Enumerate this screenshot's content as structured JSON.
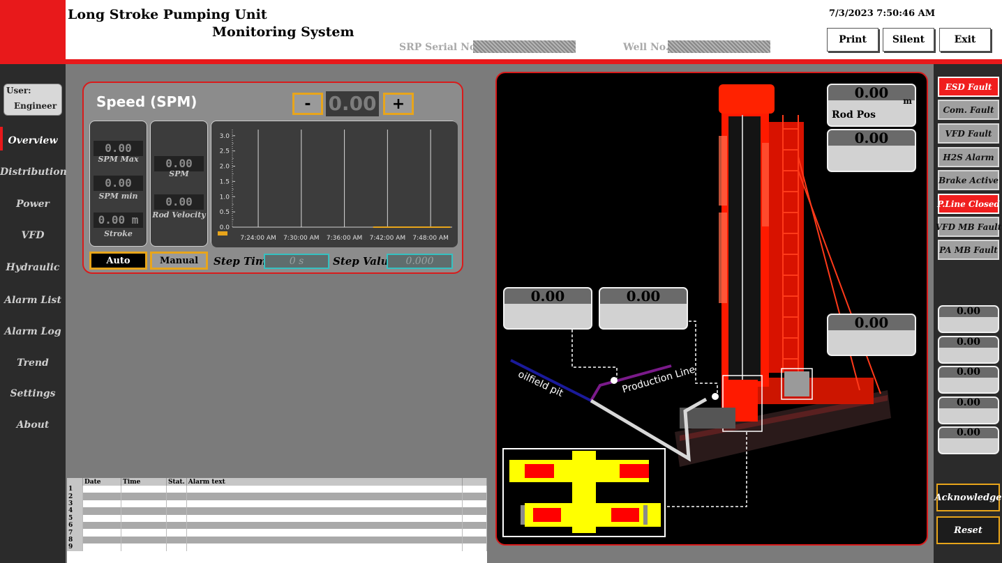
{
  "header": {
    "title_line1": "Long Stroke Pumping Unit",
    "title_line2": "Monitoring System",
    "datetime": "7/3/2023 7:50:46 AM",
    "srp_serial_label": "SRP Serial No.",
    "well_label": "Well No.",
    "buttons": {
      "print": "Print",
      "silent": "Silent",
      "exit": "Exit"
    }
  },
  "user": {
    "label": "User:",
    "name": "Engineer"
  },
  "nav": [
    "Overview",
    "Distribution",
    "Power",
    "VFD",
    "Hydraulic",
    "Alarm List",
    "Alarm Log",
    "Trend",
    "Settings",
    "About"
  ],
  "speed": {
    "title": "Speed (SPM)",
    "minus_label": "-",
    "plus_label": "+",
    "setpoint": "0.00",
    "spm_max": {
      "value": "0.00",
      "label": "SPM Max"
    },
    "spm_min": {
      "value": "0.00",
      "label": "SPM min"
    },
    "stroke": {
      "value": "0.00 m",
      "label": "Stroke"
    },
    "spm": {
      "value": "0.00",
      "label": "SPM"
    },
    "rod_velocity": {
      "value": "0.00",
      "label": "Rod Velocity"
    },
    "auto_label": "Auto",
    "manual_label": "Manual",
    "step_time_label": "Step Time",
    "step_time_value": "0 s",
    "step_value_label": "Step Value",
    "step_value_value": "0.000"
  },
  "chart_data": {
    "type": "line",
    "yticks": [
      "3.0",
      "2.5",
      "2.0",
      "1.5",
      "1.0",
      "0.5",
      "0.0"
    ],
    "ylim": [
      0,
      3.2
    ],
    "xticks": [
      "7:24:00 AM",
      "7:30:00 AM",
      "7:36:00 AM",
      "7:42:00 AM",
      "7:48:00 AM"
    ],
    "grid": true,
    "series": [
      {
        "color": "#e8a51b",
        "start_x": "7:40:00 AM",
        "end_x": "7:50:46 AM",
        "value": 0.0
      }
    ]
  },
  "alarm_table": {
    "columns": [
      "Date",
      "Time",
      "Stat.",
      "Alarm text"
    ],
    "rows": [
      "1",
      "2",
      "3",
      "4",
      "5",
      "6",
      "7",
      "8",
      "9"
    ]
  },
  "visual": {
    "rod_pos_value": "0.00",
    "rod_pos_unit": "m",
    "rod_pos_label": "Rod Pos",
    "card2_value": "0.00",
    "left_card1_value": "0.00",
    "left_card2_value": "0.00",
    "right_card_value": "0.00",
    "oilfield_pit_label": "oilfield pit",
    "production_line_label": "Production Line"
  },
  "faults": [
    {
      "label": "ESD Fault",
      "active": true
    },
    {
      "label": "Com. Fault",
      "active": false
    },
    {
      "label": "VFD Fault",
      "active": false
    },
    {
      "label": "H2S Alarm",
      "active": false
    },
    {
      "label": "Brake Active",
      "active": false
    },
    {
      "label": "P.Line Closed",
      "active": true
    },
    {
      "label": "VFD MB Fault",
      "active": false
    },
    {
      "label": "PA MB Fault",
      "active": false
    }
  ],
  "right_values": [
    "0.00",
    "0.00",
    "0.00",
    "0.00",
    "0.00"
  ],
  "actions": {
    "acknowledge": "Acknowledge",
    "reset": "Reset"
  },
  "colors": {
    "accent_red": "#e8191b",
    "button_orange": "#e8a51b",
    "teal": "#35c1c1",
    "structure_red": "#ff1a00"
  }
}
